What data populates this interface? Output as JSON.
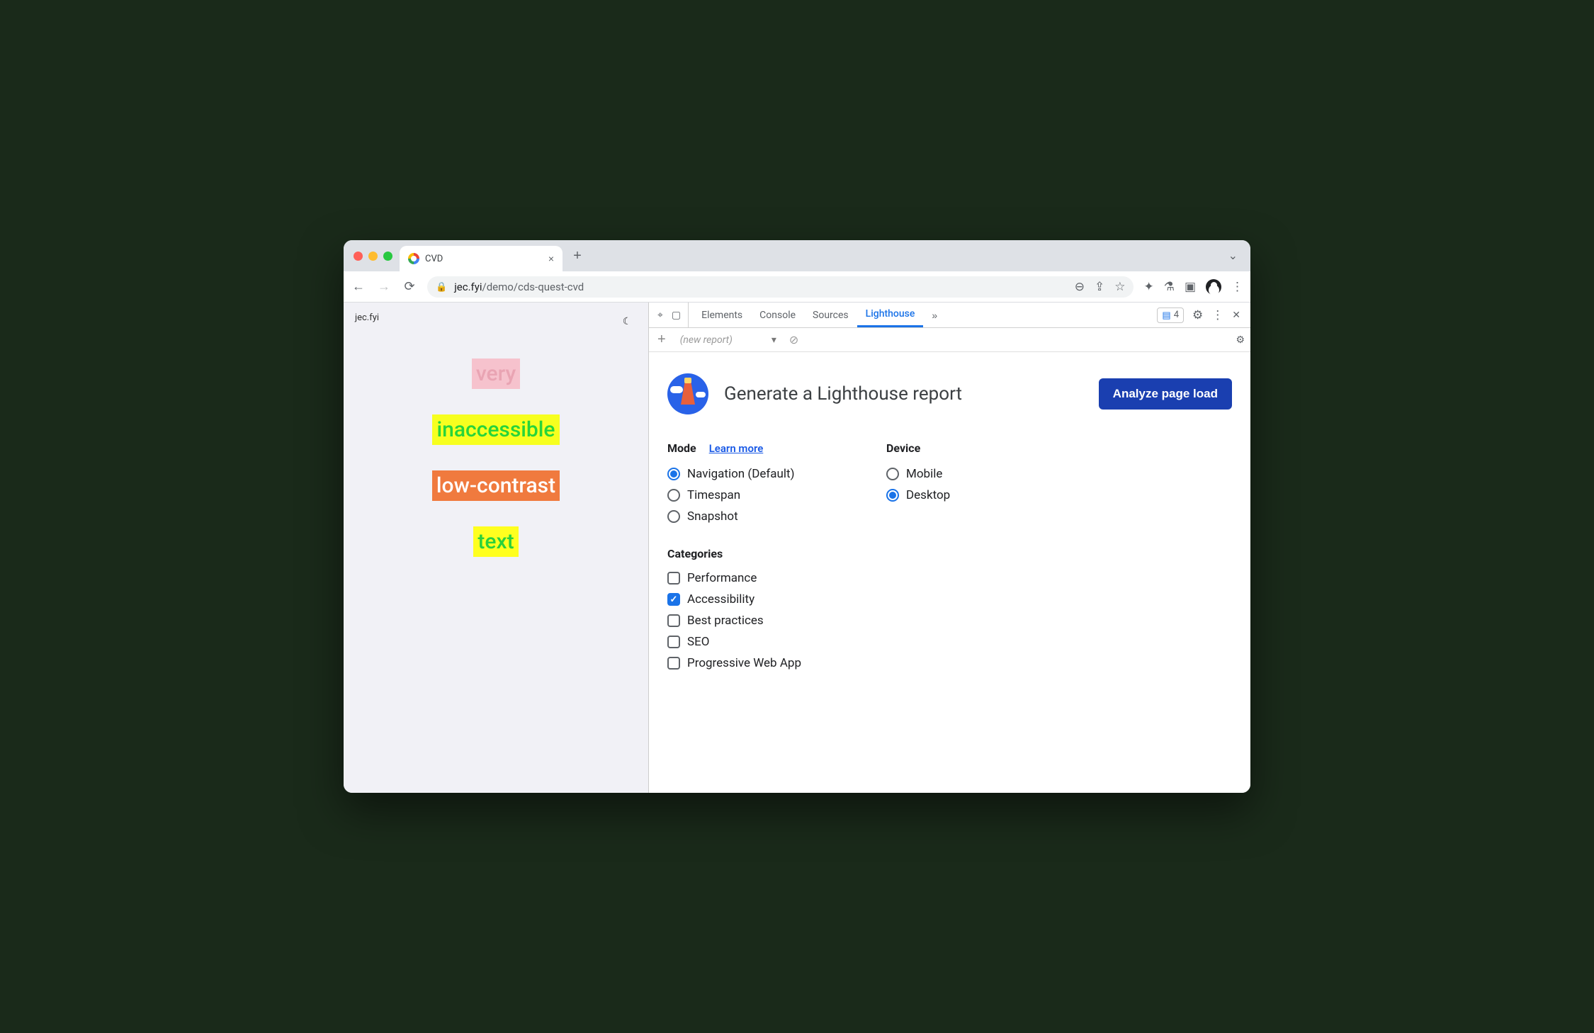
{
  "tab": {
    "title": "CVD"
  },
  "url": {
    "domain": "jec.fyi",
    "path": "/demo/cds-quest-cvd"
  },
  "page": {
    "siteTitle": "jec.fyi",
    "words": [
      {
        "text": "very",
        "fg": "#e9a4b3",
        "bg": "#f6c2cd"
      },
      {
        "text": "inaccessible",
        "fg": "#28d43a",
        "bg": "#f7ff1f"
      },
      {
        "text": "low-contrast",
        "fg": "#ffffff",
        "bg": "#f07a3e"
      },
      {
        "text": "text",
        "fg": "#2bd13b",
        "bg": "#ffff1f"
      }
    ]
  },
  "devtools": {
    "tabs": [
      "Elements",
      "Console",
      "Sources",
      "Lighthouse"
    ],
    "activeTab": "Lighthouse",
    "issuesCount": "4",
    "subbar": {
      "reportLabel": "(new report)"
    }
  },
  "lighthouse": {
    "title": "Generate a Lighthouse report",
    "analyzeLabel": "Analyze page load",
    "modeHeading": "Mode",
    "learnMore": "Learn more",
    "modes": [
      {
        "label": "Navigation (Default)",
        "checked": true
      },
      {
        "label": "Timespan",
        "checked": false
      },
      {
        "label": "Snapshot",
        "checked": false
      }
    ],
    "deviceHeading": "Device",
    "devices": [
      {
        "label": "Mobile",
        "checked": false
      },
      {
        "label": "Desktop",
        "checked": true
      }
    ],
    "categoriesHeading": "Categories",
    "categories": [
      {
        "label": "Performance",
        "checked": false
      },
      {
        "label": "Accessibility",
        "checked": true
      },
      {
        "label": "Best practices",
        "checked": false
      },
      {
        "label": "SEO",
        "checked": false
      },
      {
        "label": "Progressive Web App",
        "checked": false
      }
    ]
  }
}
